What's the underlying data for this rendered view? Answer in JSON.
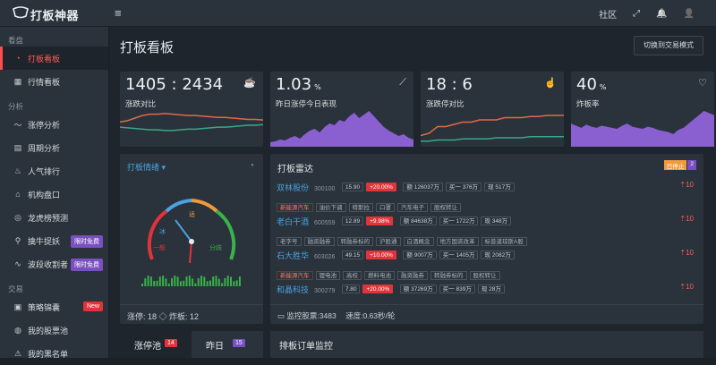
{
  "app": {
    "logo_text": "打板神器"
  },
  "topbar": {
    "community_label": "社区",
    "menu_glyph": "≡",
    "expand_glyph": "⤢",
    "bell_glyph": "🔔",
    "user_glyph": "👤"
  },
  "sidebar": {
    "sections": [
      {
        "label": "看盘",
        "items": [
          {
            "label": "打板看板",
            "icon": "gauge-icon",
            "glyph": "◔",
            "active": true
          },
          {
            "label": "行情看板",
            "icon": "grid-icon",
            "glyph": "▦"
          }
        ]
      },
      {
        "label": "分析",
        "items": [
          {
            "label": "涨停分析",
            "icon": "trend-icon",
            "glyph": "〜"
          },
          {
            "label": "周期分析",
            "icon": "chart-icon",
            "glyph": "▤"
          },
          {
            "label": "人气排行",
            "icon": "fire-icon",
            "glyph": "♨"
          },
          {
            "label": "机构盘口",
            "icon": "bank-icon",
            "glyph": "⌂"
          },
          {
            "label": "龙虎榜预测",
            "icon": "target-icon",
            "glyph": "◎"
          },
          {
            "label": "擒牛捉妖",
            "icon": "pin-icon",
            "glyph": "⚲",
            "badge": "限时免费",
            "badge_color": "#7a4fc2"
          },
          {
            "label": "波段收割者",
            "icon": "wave-icon",
            "glyph": "∿",
            "badge": "限时免费",
            "badge_color": "#7a4fc2"
          }
        ]
      },
      {
        "label": "交易",
        "items": [
          {
            "label": "策略锦囊",
            "icon": "bag-icon",
            "glyph": "▣",
            "badge": "New",
            "badge_color": "#e0343a"
          },
          {
            "label": "我的股票池",
            "icon": "pool-icon",
            "glyph": "◍"
          },
          {
            "label": "我的黑名单",
            "icon": "alert-icon",
            "glyph": "⚠"
          }
        ]
      }
    ]
  },
  "main": {
    "title": "打板看板",
    "switch_button": "切换到交易模式",
    "stats": [
      {
        "value": "1405 : 2434",
        "unit": "",
        "label": "涨跌对比",
        "icon": "cup-icon",
        "glyph": "☕"
      },
      {
        "value": "1.03",
        "unit": "%",
        "label": "昨日涨停今日表现",
        "icon": "trend-up-icon",
        "glyph": "⟋"
      },
      {
        "value": "18 : 6",
        "unit": "",
        "label": "涨跌停对比",
        "icon": "hand-icon",
        "glyph": "☝"
      },
      {
        "value": "40",
        "unit": "%",
        "label": "炸板率",
        "icon": "thumb-down-icon",
        "glyph": "♡"
      }
    ],
    "mood": {
      "title": "打板情绪",
      "caret": "▾",
      "gauge_labels": {
        "ice": "冰",
        "normal": "一般",
        "good": "适",
        "split": "分歧"
      },
      "footer": "涨停: 18 ◇ 炸板: 12"
    },
    "radar": {
      "title": "打板雷达",
      "badge_a": "已停止",
      "badge_b": "2",
      "rows": [
        {
          "name": "双林股份",
          "code": "300100",
          "price": "15.90",
          "change": "+20.00%",
          "seal": "额 126037万",
          "buy": "买一 376万",
          "flow": "现 517万",
          "tags": [
            "新能源汽车",
            "油价下调",
            "特斯拉",
            "口罩",
            "汽车电子",
            "股权转让"
          ],
          "count": "10"
        },
        {
          "name": "老白干酒",
          "code": "600559",
          "price": "12.89",
          "change": "+9.98%",
          "seal": "额 84638万",
          "buy": "买一 1722万",
          "flow": "现 348万",
          "tags": [
            "老字号",
            "融资融券",
            "转融券标的",
            "沪股通",
            "白酒概念",
            "地方国资改革",
            "标普道琼斯A股"
          ],
          "count": "10"
        },
        {
          "name": "石大胜华",
          "code": "603026",
          "price": "49.15",
          "change": "+10.00%",
          "seal": "额 9007万",
          "buy": "买一 1405万",
          "flow": "现 2082万",
          "tags": [
            "新能源汽车",
            "锂电池",
            "高校",
            "燃料电池",
            "融资融券",
            "转融券标的",
            "股权转让"
          ],
          "count": "10"
        },
        {
          "name": "和晶科技",
          "code": "300279",
          "price": "7.80",
          "change": "+20.00%",
          "seal": "额 37269万",
          "buy": "买一 839万",
          "flow": "现 28万",
          "tags": [],
          "count": "10"
        }
      ],
      "footer_label": "监控股票:",
      "footer_count": "3483",
      "footer_speed": "速度:0.63秒/轮"
    },
    "tabs": [
      {
        "label": "涨停池",
        "count": "14",
        "color": "#e0343a"
      },
      {
        "label": "昨日",
        "count": "15",
        "color": "#7a4fc2"
      }
    ],
    "order_monitor": "排板订单监控"
  },
  "chart_data": [
    {
      "type": "line",
      "title": "",
      "series": [
        {
          "values": [
            38,
            40,
            44,
            48,
            50,
            50,
            51,
            50,
            49,
            48,
            48,
            47,
            46,
            45,
            45,
            44,
            43,
            42,
            42,
            41
          ]
        },
        {
          "values": [
            30,
            29,
            28,
            27,
            26,
            26,
            25,
            25,
            26,
            27,
            27,
            28,
            29,
            30,
            30,
            31,
            32,
            33,
            33,
            34
          ]
        }
      ]
    },
    {
      "type": "area",
      "title": "",
      "values": [
        5,
        6,
        8,
        7,
        10,
        12,
        9,
        14,
        18,
        20,
        16,
        22,
        26,
        24,
        30,
        28,
        34,
        38,
        32,
        36,
        40,
        34,
        28,
        22,
        18,
        15,
        12,
        14,
        10,
        8
      ]
    },
    {
      "type": "line",
      "title": "",
      "series": [
        {
          "values": [
            10,
            12,
            18,
            18,
            20,
            22,
            22,
            24,
            24,
            24,
            26,
            26,
            26,
            27,
            27,
            28,
            28,
            28
          ]
        },
        {
          "values": [
            5,
            5,
            6,
            6,
            6,
            7,
            7,
            7,
            7,
            8,
            8,
            8,
            8,
            9,
            9,
            9,
            9,
            9
          ]
        }
      ]
    },
    {
      "type": "area",
      "title": "",
      "values": [
        22,
        20,
        18,
        21,
        19,
        18,
        20,
        19,
        18,
        17,
        20,
        22,
        19,
        18,
        17,
        19,
        18,
        16,
        15,
        14,
        12,
        16,
        18,
        22,
        26,
        30,
        34,
        32,
        30
      ]
    }
  ]
}
